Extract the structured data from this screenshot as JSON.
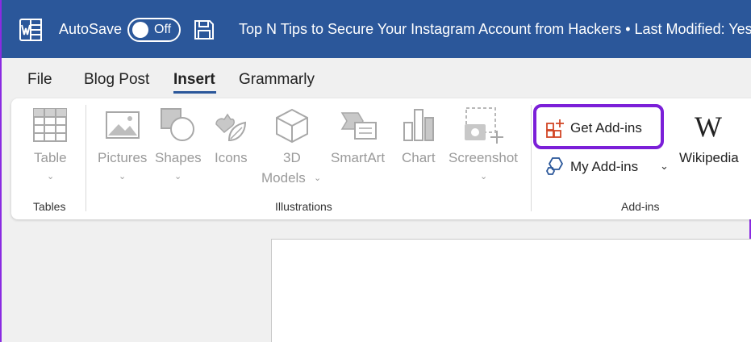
{
  "titlebar": {
    "autosave_label": "AutoSave",
    "toggle_state": "Off",
    "document_title": "Top N Tips to Secure Your Instagram Account from Hackers • Last Modified: Yeste"
  },
  "tabs": [
    {
      "label": "File"
    },
    {
      "label": "Blog Post"
    },
    {
      "label": "Insert"
    },
    {
      "label": "Grammarly"
    }
  ],
  "ribbon": {
    "tables": {
      "table_label": "Table",
      "group_label": "Tables"
    },
    "illustrations": {
      "pictures_label": "Pictures",
      "shapes_label": "Shapes",
      "icons_label": "Icons",
      "models_line1": "3D",
      "models_line2": "Models",
      "smartart_label": "SmartArt",
      "chart_label": "Chart",
      "screenshot_label": "Screenshot",
      "group_label": "Illustrations"
    },
    "addins": {
      "get_addins_label": "Get Add-ins",
      "my_addins_label": "My Add-ins",
      "wikipedia_label": "Wikipedia",
      "wikipedia_logo": "W",
      "group_label": "Add-ins"
    }
  },
  "colors": {
    "titlebar": "#2b579a",
    "highlight": "#7b1fd8",
    "accent_orange": "#d24726"
  }
}
